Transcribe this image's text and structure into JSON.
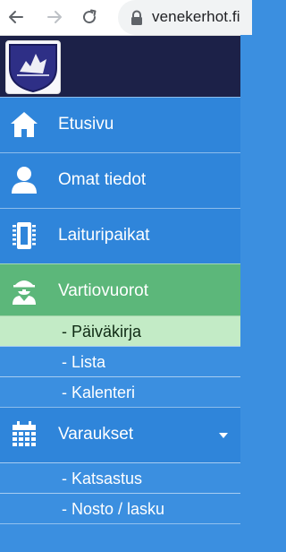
{
  "browser": {
    "url": "venekerhot.fi",
    "back_icon": "arrow-left-icon",
    "forward_icon": "arrow-right-icon",
    "reload_icon": "reload-icon",
    "lock_icon": "lock-icon"
  },
  "header": {
    "logo_icon": "club-logo-icon"
  },
  "menu": {
    "items": [
      {
        "label": "Etusivu",
        "icon": "home-icon"
      },
      {
        "label": "Omat tiedot",
        "icon": "user-icon"
      },
      {
        "label": "Laituripaikat",
        "icon": "memory-chip-icon"
      },
      {
        "label": "Vartiovuorot",
        "icon": "spy-icon",
        "active": true
      },
      {
        "label": "Varaukset",
        "icon": "calendar-icon",
        "expanded": true
      }
    ],
    "vartiovuorot_sub": [
      {
        "label": "- Päiväkirja",
        "active": true
      },
      {
        "label": "- Lista"
      },
      {
        "label": "- Kalenteri"
      }
    ],
    "varaukset_sub": [
      {
        "label": "- Katsastus"
      },
      {
        "label": "- Nosto / lasku"
      }
    ]
  },
  "colors": {
    "menu_blue": "#2f85da",
    "sub_blue": "#3b8fe0",
    "active_green": "#5cb77a",
    "active_sub_green": "#c3ebc6",
    "header_navy": "#1c2148"
  }
}
